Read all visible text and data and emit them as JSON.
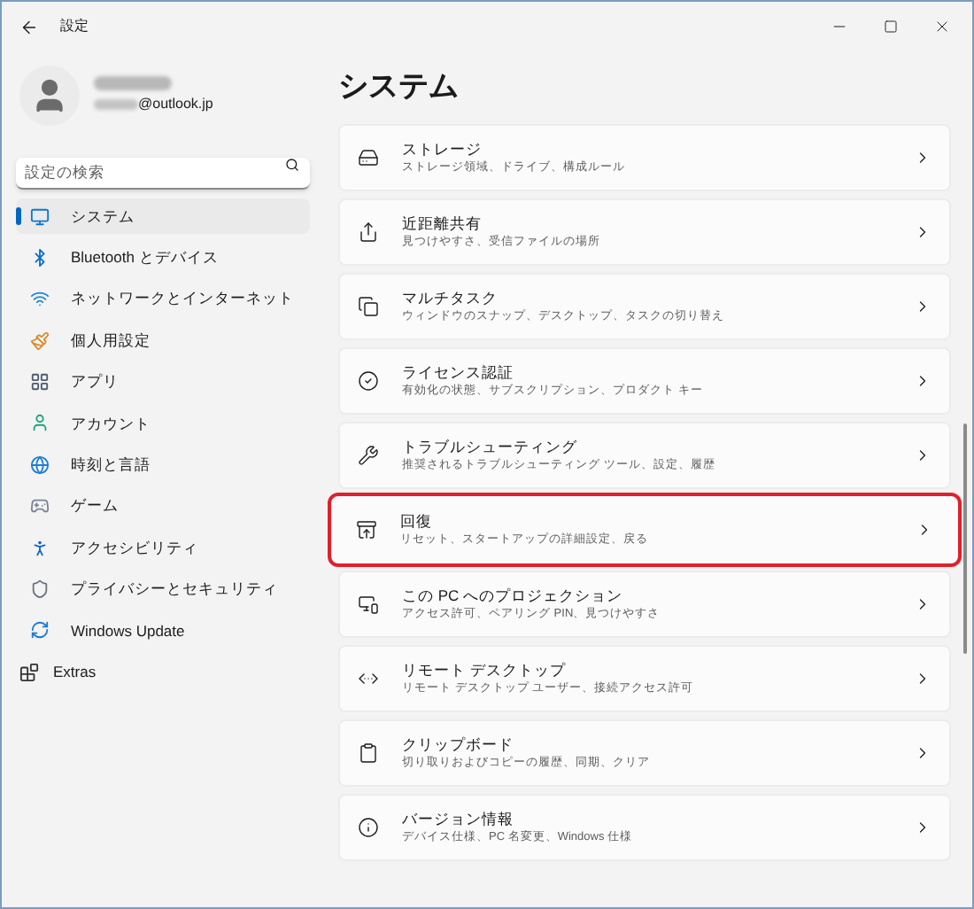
{
  "window": {
    "title": "設定"
  },
  "account": {
    "email": "@outlook.jp"
  },
  "search": {
    "placeholder": "設定の検索"
  },
  "sidebar": {
    "items": [
      {
        "label": "システム",
        "selected": true
      },
      {
        "label": "Bluetooth とデバイス",
        "selected": false
      },
      {
        "label": "ネットワークとインターネット",
        "selected": false
      },
      {
        "label": "個人用設定",
        "selected": false
      },
      {
        "label": "アプリ",
        "selected": false
      },
      {
        "label": "アカウント",
        "selected": false
      },
      {
        "label": "時刻と言語",
        "selected": false
      },
      {
        "label": "ゲーム",
        "selected": false
      },
      {
        "label": "アクセシビリティ",
        "selected": false
      },
      {
        "label": "プライバシーとセキュリティ",
        "selected": false
      },
      {
        "label": "Windows Update",
        "selected": false
      },
      {
        "label": "Extras",
        "selected": false
      }
    ]
  },
  "page": {
    "title": "システム",
    "items": [
      {
        "title": "ストレージ",
        "subtitle": "ストレージ領域、ドライブ、構成ルール",
        "highlighted": false
      },
      {
        "title": "近距離共有",
        "subtitle": "見つけやすさ、受信ファイルの場所",
        "highlighted": false
      },
      {
        "title": "マルチタスク",
        "subtitle": "ウィンドウのスナップ、デスクトップ、タスクの切り替え",
        "highlighted": false
      },
      {
        "title": "ライセンス認証",
        "subtitle": "有効化の状態、サブスクリプション、プロダクト キー",
        "highlighted": false
      },
      {
        "title": "トラブルシューティング",
        "subtitle": "推奨されるトラブルシューティング ツール、設定、履歴",
        "highlighted": false
      },
      {
        "title": "回復",
        "subtitle": "リセット、スタートアップの詳細設定、戻る",
        "highlighted": true
      },
      {
        "title": "この PC へのプロジェクション",
        "subtitle": "アクセス許可、ペアリング PIN、見つけやすさ",
        "highlighted": false
      },
      {
        "title": "リモート デスクトップ",
        "subtitle": "リモート デスクトップ ユーザー、接続アクセス許可",
        "highlighted": false
      },
      {
        "title": "クリップボード",
        "subtitle": "切り取りおよびコピーの履歴、同期、クリア",
        "highlighted": false
      },
      {
        "title": "バージョン情報",
        "subtitle": "デバイス仕様、PC 名変更、Windows 仕様",
        "highlighted": false
      }
    ]
  }
}
